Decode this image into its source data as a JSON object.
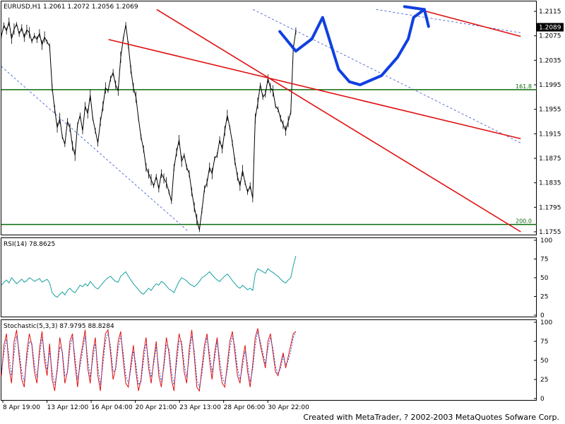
{
  "chart_data": [
    {
      "type": "line",
      "title": "EURUSD,H1",
      "header_values": "1.2061 1.2072 1.2056 1.2069",
      "last_price_label": "1.2089",
      "y_ticks": [
        "1.2115",
        "1.2075",
        "1.2035",
        "1.1995",
        "1.1955",
        "1.1915",
        "1.1875",
        "1.1835",
        "1.1795",
        "1.1755"
      ],
      "ylim": [
        1.1755,
        1.2115
      ],
      "x_ticks": [
        "8 Apr 19:00",
        "13 Apr 12:00",
        "16 Apr 04:00",
        "20 Apr 21:00",
        "23 Apr 13:00",
        "28 Apr 06:00",
        "30 Apr 22:00"
      ],
      "fibo_levels": [
        {
          "label": "161.8",
          "value": 1.1987,
          "color": "#0a6b0a"
        },
        {
          "label": "200.0",
          "value": 1.1767,
          "color": "#0a6b0a"
        }
      ],
      "price_series": [
        1.2075,
        1.2092,
        1.2083,
        1.2098,
        1.207,
        1.2086,
        1.2094,
        1.2078,
        1.2088,
        1.2072,
        1.2085,
        1.208,
        1.2066,
        1.2075,
        1.2069,
        1.2079,
        1.206,
        1.2073,
        1.2065,
        1.2058,
        1.199,
        1.1955,
        1.1925,
        1.194,
        1.191,
        1.1898,
        1.1935,
        1.1925,
        1.1895,
        1.188,
        1.193,
        1.1945,
        1.192,
        1.196,
        1.1948,
        1.1978,
        1.194,
        1.192,
        1.19,
        1.1935,
        1.196,
        1.199,
        1.1985,
        1.2005,
        1.2015,
        1.1995,
        1.1985,
        1.204,
        1.207,
        1.2093,
        1.206,
        1.202,
        1.199,
        1.1975,
        1.194,
        1.191,
        1.189,
        1.186,
        1.185,
        1.184,
        1.183,
        1.1845,
        1.1825,
        1.185,
        1.1842,
        1.1835,
        1.182,
        1.1805,
        1.186,
        1.1885,
        1.1905,
        1.187,
        1.188,
        1.186,
        1.185,
        1.182,
        1.1795,
        1.1775,
        1.1758,
        1.179,
        1.1825,
        1.1835,
        1.186,
        1.185,
        1.1875,
        1.188,
        1.1905,
        1.189,
        1.192,
        1.1945,
        1.1925,
        1.19,
        1.187,
        1.1845,
        1.183,
        1.1855,
        1.1835,
        1.182,
        1.183,
        1.181,
        1.194,
        1.1965,
        1.1995,
        1.1975,
        1.198,
        1.2005,
        1.199,
        1.1985,
        1.196,
        1.1955,
        1.194,
        1.193,
        1.192,
        1.1935,
        1.195,
        1.2055,
        1.2083
      ],
      "trend_lines": [
        {
          "name": "red-line-1",
          "color": "#e01010",
          "p1": [
            0.29,
            1.2118
          ],
          "p2": [
            0.97,
            1.1755
          ]
        },
        {
          "name": "red-line-2",
          "color": "#e01010",
          "p1": [
            0.2,
            1.2069
          ],
          "p2": [
            0.97,
            1.1907
          ]
        },
        {
          "name": "red-line-3",
          "color": "#e01010",
          "p1": [
            0.78,
            1.2118
          ],
          "p2": [
            0.97,
            1.2074
          ]
        }
      ],
      "dashed_lines": [
        {
          "name": "blue-dashed-1",
          "color": "#3050d0",
          "p1": [
            0.0,
            1.2025
          ],
          "p2": [
            0.35,
            1.1755
          ]
        },
        {
          "name": "blue-dashed-2",
          "color": "#3050d0",
          "p1": [
            0.47,
            1.2118
          ],
          "p2": [
            0.97,
            1.19
          ]
        },
        {
          "name": "blue-dashed-3",
          "color": "#3050d0",
          "p1": [
            0.7,
            1.2118
          ],
          "p2": [
            0.97,
            1.208
          ]
        }
      ],
      "projection_path": [
        [
          0.52,
          1.2082
        ],
        [
          0.55,
          1.205
        ],
        [
          0.58,
          1.207
        ],
        [
          0.6,
          1.2105
        ],
        [
          0.63,
          1.202
        ],
        [
          0.65,
          1.2
        ],
        [
          0.67,
          1.1995
        ],
        [
          0.71,
          1.201
        ],
        [
          0.74,
          1.204
        ],
        [
          0.76,
          1.207
        ],
        [
          0.77,
          1.2105
        ],
        [
          0.79,
          1.2118
        ]
      ]
    },
    {
      "type": "line",
      "title": "RSI(14)",
      "value_label": "78.8625",
      "y_ticks": [
        "100",
        "75",
        "50",
        "25",
        "0"
      ],
      "ylim": [
        0,
        100
      ],
      "color": "#1aa0a0",
      "values": [
        40,
        44,
        47,
        43,
        50,
        46,
        42,
        45,
        48,
        44,
        46,
        50,
        48,
        45,
        47,
        49,
        44,
        46,
        48,
        43,
        30,
        26,
        24,
        28,
        31,
        27,
        33,
        36,
        32,
        30,
        35,
        40,
        38,
        42,
        39,
        45,
        41,
        37,
        35,
        39,
        43,
        47,
        50,
        52,
        48,
        45,
        44,
        52,
        55,
        58,
        52,
        47,
        42,
        38,
        34,
        30,
        28,
        32,
        36,
        33,
        38,
        42,
        40,
        45,
        43,
        39,
        35,
        33,
        30,
        38,
        45,
        50,
        48,
        46,
        42,
        40,
        38,
        41,
        45,
        50,
        52,
        55,
        58,
        54,
        50,
        47,
        45,
        49,
        52,
        55,
        51,
        46,
        42,
        38,
        36,
        40,
        37,
        34,
        36,
        33,
        55,
        62,
        60,
        58,
        56,
        62,
        59,
        57,
        54,
        52,
        48,
        45,
        43,
        47,
        50,
        66,
        79
      ]
    },
    {
      "type": "line",
      "title": "Stochastic(5,3,3)",
      "value_label": "87.9795 88.8284",
      "y_ticks": [
        "100",
        "75",
        "50",
        "25",
        "0"
      ],
      "ylim": [
        0,
        100
      ],
      "series": [
        {
          "color": "#e01010",
          "values": [
            30,
            70,
            85,
            40,
            20,
            75,
            90,
            55,
            25,
            15,
            60,
            85,
            70,
            35,
            20,
            65,
            88,
            50,
            30,
            72,
            25,
            10,
            40,
            80,
            60,
            20,
            35,
            75,
            85,
            45,
            15,
            50,
            70,
            90,
            40,
            20,
            60,
            80,
            30,
            10,
            55,
            85,
            90,
            60,
            25,
            40,
            75,
            88,
            50,
            20,
            15,
            45,
            70,
            35,
            10,
            25,
            60,
            80,
            40,
            20,
            50,
            75,
            30,
            15,
            45,
            80,
            60,
            25,
            10,
            55,
            85,
            70,
            35,
            20,
            65,
            90,
            55,
            15,
            10,
            40,
            70,
            85,
            50,
            25,
            60,
            80,
            40,
            20,
            15,
            45,
            75,
            88,
            60,
            30,
            20,
            50,
            70,
            35,
            15,
            45,
            80,
            92,
            70,
            55,
            40,
            75,
            85,
            60,
            35,
            30,
            45,
            60,
            40,
            55,
            70,
            85,
            88
          ]
        },
        {
          "color": "#3050d0",
          "values": [
            35,
            60,
            78,
            55,
            30,
            60,
            82,
            62,
            35,
            22,
            50,
            75,
            72,
            45,
            28,
            55,
            80,
            58,
            38,
            62,
            35,
            18,
            35,
            68,
            62,
            30,
            33,
            65,
            80,
            55,
            25,
            42,
            62,
            82,
            52,
            28,
            52,
            72,
            42,
            18,
            45,
            75,
            86,
            68,
            35,
            38,
            65,
            82,
            60,
            30,
            20,
            38,
            62,
            45,
            18,
            22,
            50,
            72,
            50,
            28,
            45,
            68,
            40,
            22,
            40,
            70,
            65,
            35,
            18,
            45,
            75,
            75,
            45,
            28,
            55,
            82,
            62,
            25,
            15,
            32,
            60,
            80,
            60,
            35,
            52,
            75,
            52,
            28,
            20,
            38,
            65,
            82,
            68,
            40,
            25,
            42,
            62,
            45,
            22,
            38,
            70,
            88,
            75,
            60,
            45,
            65,
            80,
            65,
            42,
            32,
            40,
            55,
            45,
            50,
            62,
            80,
            87
          ]
        }
      ]
    }
  ],
  "footer_text": "Created with MetaTrader, ? 2002-2003 MetaQuotes Sofware Corp."
}
